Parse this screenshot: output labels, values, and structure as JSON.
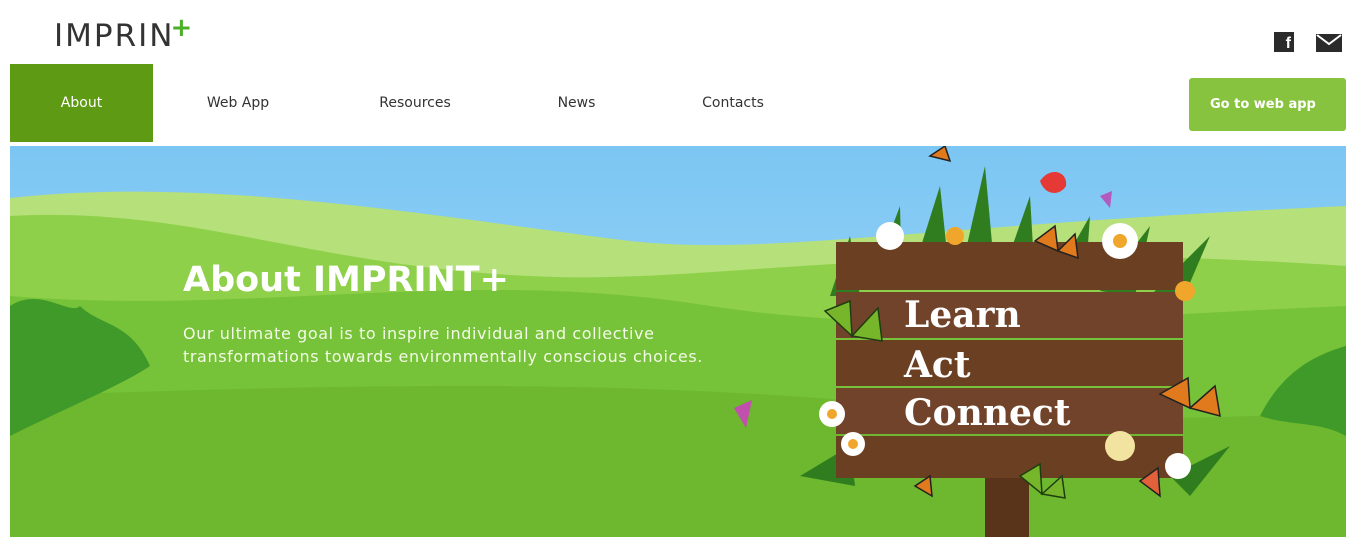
{
  "header": {
    "logo_text": "IMPRIN",
    "logo_suffix": "+",
    "social": {
      "facebook_label": "f",
      "icons": [
        "facebook-icon",
        "mail-icon"
      ]
    }
  },
  "nav": {
    "items": [
      {
        "label": "About",
        "active": true
      },
      {
        "label": "Web App",
        "active": false
      },
      {
        "label": "Resources",
        "active": false
      },
      {
        "label": "News",
        "active": false
      },
      {
        "label": "Contacts",
        "active": false
      }
    ],
    "cta_label": "Go to web app"
  },
  "hero": {
    "title": "About IMPRINT+",
    "text": "Our ultimate goal is to inspire individual and collective transformations towards environmentally conscious choices.",
    "sign_words": [
      "Learn",
      "Act",
      "Connect"
    ]
  },
  "colors": {
    "nav_active": "#5f9a14",
    "cta": "#87c33f",
    "sky": "#8fd0f7",
    "grass": "#7cc83c",
    "board": "#6b3f22"
  }
}
